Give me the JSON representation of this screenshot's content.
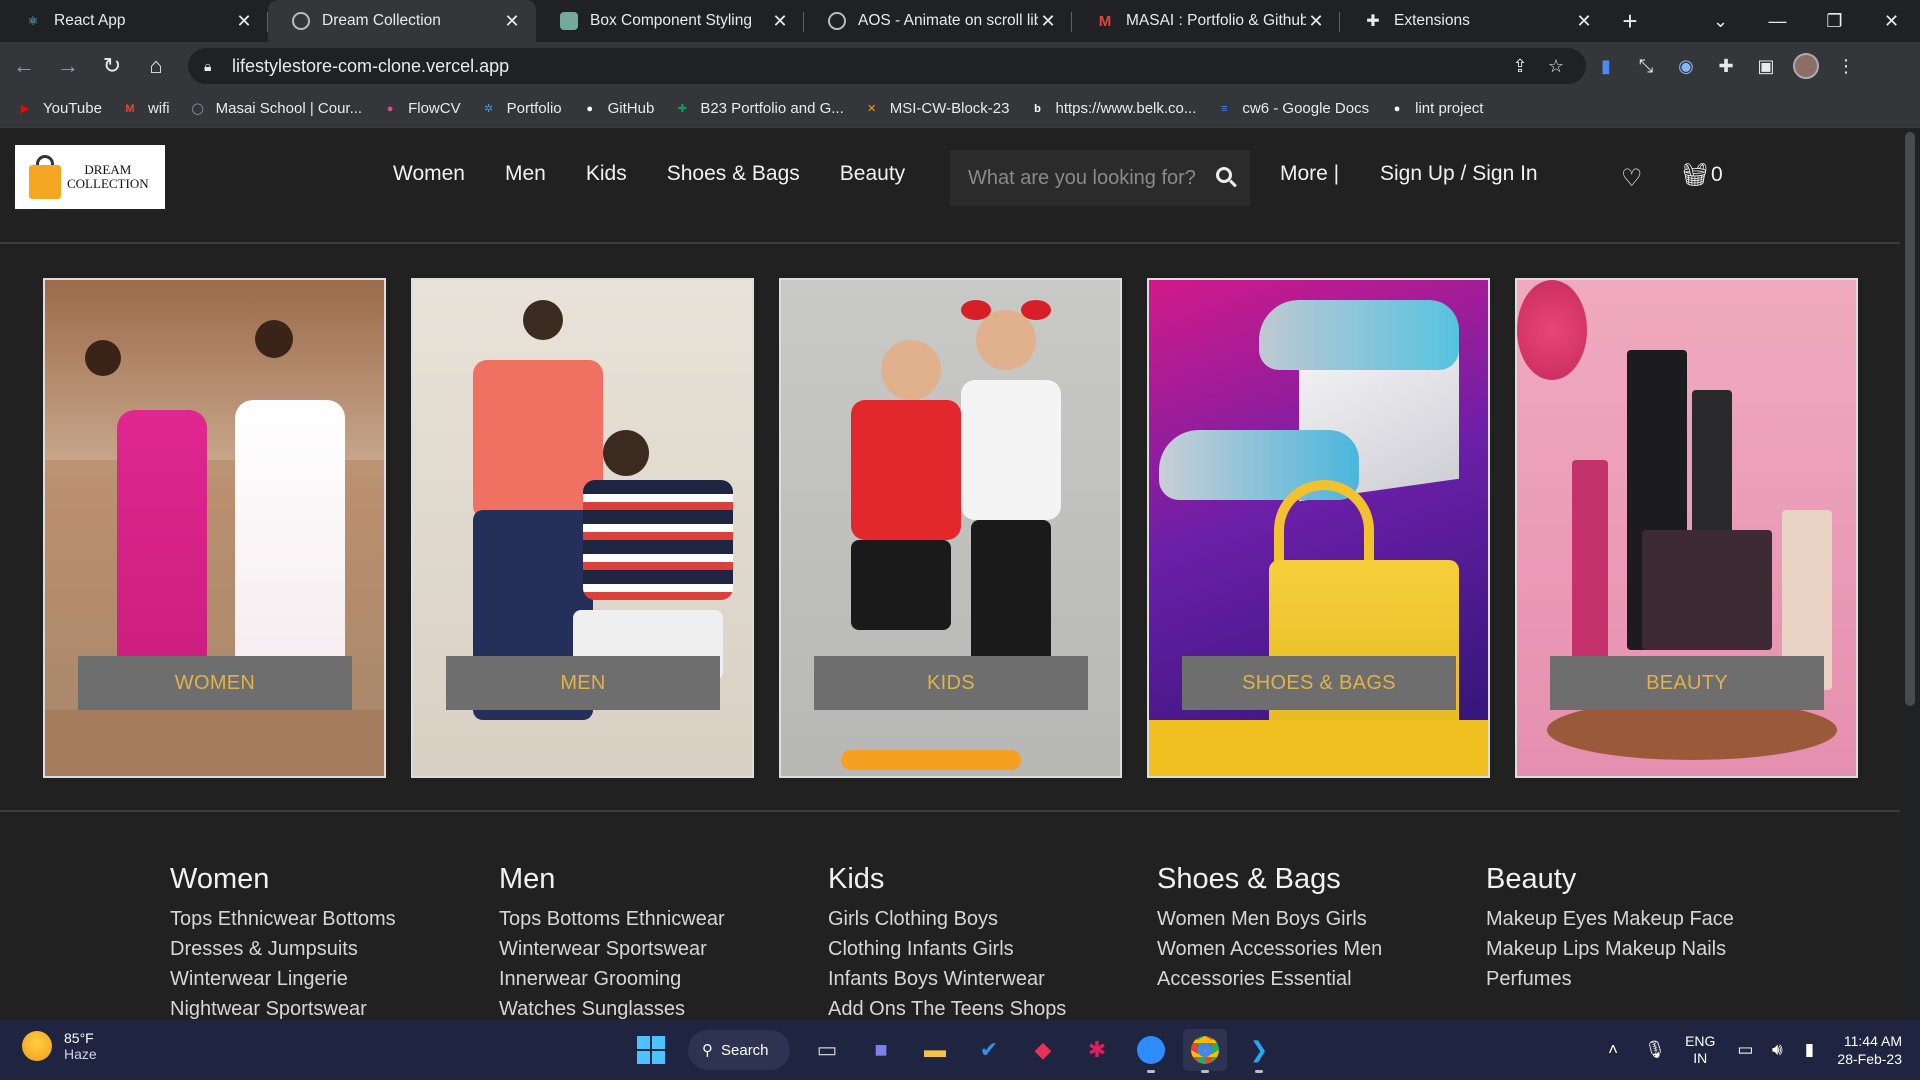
{
  "browser": {
    "tabs": [
      {
        "title": "React App",
        "icon": "react-icon",
        "active": false
      },
      {
        "title": "Dream Collection",
        "icon": "globe-icon",
        "active": true
      },
      {
        "title": "Box Component Styling",
        "icon": "chatgpt-icon",
        "active": false
      },
      {
        "title": "AOS - Animate on scroll libr",
        "icon": "globe-icon",
        "active": false
      },
      {
        "title": "MASAI : Portfolio & Github",
        "icon": "gmail-icon",
        "active": false
      },
      {
        "title": "Extensions",
        "icon": "puzzle-icon",
        "active": false
      }
    ],
    "url": "lifestylestore-com-clone.vercel.app",
    "bookmarks": [
      {
        "label": "YouTube",
        "icon": "youtube-icon",
        "color": "#ff0000"
      },
      {
        "label": "wifi",
        "icon": "gmail-icon",
        "color": "#ea4335"
      },
      {
        "label": "Masai School | Cour...",
        "icon": "globe-icon",
        "color": "#9aa0a6"
      },
      {
        "label": "FlowCV",
        "icon": "flowcv-icon",
        "color": "#e84393"
      },
      {
        "label": "Portfolio",
        "icon": "gear-icon",
        "color": "#4a90e2"
      },
      {
        "label": "GitHub",
        "icon": "github-icon",
        "color": "#ffffff"
      },
      {
        "label": "B23 Portfolio and G...",
        "icon": "sheets-icon",
        "color": "#0f9d58"
      },
      {
        "label": "MSI-CW-Block-23",
        "icon": "tools-icon",
        "color": "#f39c12"
      },
      {
        "label": "https://www.belk.co...",
        "icon": "belk-icon",
        "color": "#ffffff"
      },
      {
        "label": "cw6 - Google Docs",
        "icon": "docs-icon",
        "color": "#4285f4"
      },
      {
        "label": "lint project",
        "icon": "github-icon",
        "color": "#ffffff"
      }
    ]
  },
  "site": {
    "logo_line1": "DREAM",
    "logo_line2": "COLLECTION",
    "menu": [
      "Women",
      "Men",
      "Kids",
      "Shoes & Bags",
      "Beauty"
    ],
    "search_placeholder": "What are you looking for?",
    "more": "More |",
    "signin": "Sign Up / Sign In",
    "cart_count": "0",
    "cards": [
      {
        "label": "WOMEN"
      },
      {
        "label": "MEN"
      },
      {
        "label": "KIDS"
      },
      {
        "label": "SHOES & BAGS"
      },
      {
        "label": "BEAUTY"
      }
    ],
    "footer": [
      {
        "heading": "Women",
        "links": [
          "Tops Ethnicwear Bottoms",
          "Dresses & Jumpsuits",
          "Winterwear Lingerie",
          "Nightwear Sportswear"
        ]
      },
      {
        "heading": "Men",
        "links": [
          "Tops Bottoms Ethnicwear",
          "Winterwear Sportswear",
          "Innerwear Grooming",
          "Watches Sunglasses"
        ]
      },
      {
        "heading": "Kids",
        "links": [
          "Girls Clothing Boys",
          "Clothing Infants Girls",
          "Infants Boys Winterwear",
          "Add Ons The Teens Shops"
        ]
      },
      {
        "heading": "Shoes & Bags",
        "links": [
          "Women Men Boys Girls",
          "Women Accessories Men",
          "Accessories Essential"
        ]
      },
      {
        "heading": "Beauty",
        "links": [
          "Makeup Eyes Makeup Face",
          "Makeup Lips Makeup Nails",
          "Perfumes"
        ]
      }
    ]
  },
  "taskbar": {
    "temp": "85°F",
    "weather": "Haze",
    "search_label": "Search",
    "lang1": "ENG",
    "lang2": "IN",
    "time": "11:44 AM",
    "date": "28-Feb-23"
  }
}
